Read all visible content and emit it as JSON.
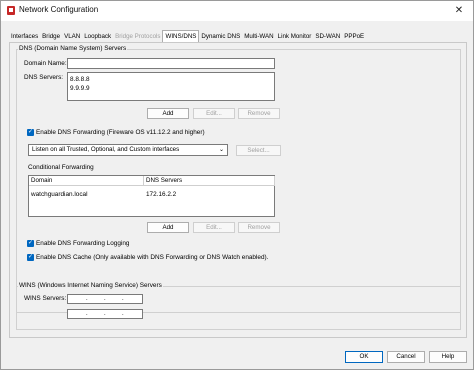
{
  "window": {
    "title": "Network Configuration",
    "close_glyph": "✕"
  },
  "tabs": [
    {
      "label": "Interfaces",
      "disabled": false
    },
    {
      "label": "Bridge",
      "disabled": false
    },
    {
      "label": "VLAN",
      "disabled": false
    },
    {
      "label": "Loopback",
      "disabled": false
    },
    {
      "label": "Bridge Protocols",
      "disabled": true
    },
    {
      "label": "WINS/DNS",
      "disabled": false,
      "active": true
    },
    {
      "label": "Dynamic DNS",
      "disabled": false
    },
    {
      "label": "Multi-WAN",
      "disabled": false
    },
    {
      "label": "Link Monitor",
      "disabled": false
    },
    {
      "label": "SD-WAN",
      "disabled": false
    },
    {
      "label": "PPPoE",
      "disabled": false
    }
  ],
  "dns": {
    "group_title": "DNS (Domain Name System) Servers",
    "domain_name_label": "Domain Name:",
    "domain_name_value": "",
    "dns_servers_label": "DNS Servers:",
    "dns_servers": [
      "8.8.8.8",
      "9.9.9.9"
    ],
    "add_label": "Add",
    "edit_label": "Edit...",
    "remove_label": "Remove",
    "forwarding_checkbox_label": "Enable DNS Forwarding (Fireware OS v11.12.2 and higher)",
    "forwarding_checked": true,
    "listen_select_value": "Listen on all Trusted, Optional, and Custom interfaces",
    "select_button_label": "Select...",
    "conditional_title": "Conditional Forwarding",
    "table_headers": {
      "domain": "Domain",
      "dns_servers": "DNS Servers"
    },
    "table_rows": [
      {
        "domain": "watchguardian.local",
        "dns_servers": "172.16.2.2"
      }
    ],
    "cf_add_label": "Add",
    "cf_edit_label": "Edit...",
    "cf_remove_label": "Remove",
    "logging_checkbox_label": "Enable DNS Forwarding Logging",
    "logging_checked": true,
    "cache_checkbox_label": "Enable DNS Cache (Only available with DNS Forwarding or DNS Watch enabled).",
    "cache_checked": true
  },
  "wins": {
    "group_title": "WINS (Windows Internet Naming Service) Servers",
    "servers_label": "WINS Servers:",
    "dot": "."
  },
  "footer": {
    "ok_label": "OK",
    "cancel_label": "Cancel",
    "help_label": "Help"
  },
  "colors": {
    "checkbox_accent": "#0067c0"
  }
}
